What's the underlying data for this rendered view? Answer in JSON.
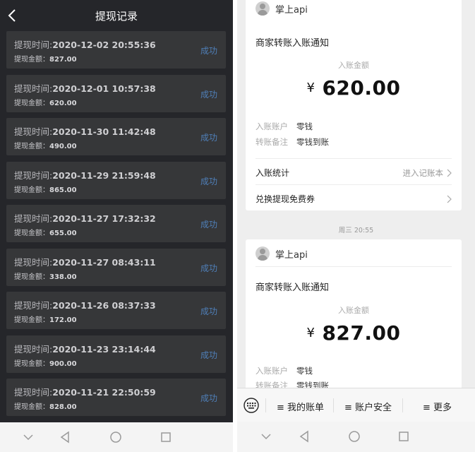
{
  "left": {
    "header_title": "提现记录",
    "time_prefix": "提现时间:",
    "amount_prefix": "提现金额：",
    "records": [
      {
        "time": "2020-12-02 20:55:36",
        "amount": "827.00",
        "status": "成功"
      },
      {
        "time": "2020-12-01 10:57:38",
        "amount": "620.00",
        "status": "成功"
      },
      {
        "time": "2020-11-30 11:42:48",
        "amount": "490.00",
        "status": "成功"
      },
      {
        "time": "2020-11-29 21:59:48",
        "amount": "865.00",
        "status": "成功"
      },
      {
        "time": "2020-11-27 17:32:32",
        "amount": "655.00",
        "status": "成功"
      },
      {
        "time": "2020-11-27 08:43:11",
        "amount": "338.00",
        "status": "成功"
      },
      {
        "time": "2020-11-26 08:37:33",
        "amount": "172.00",
        "status": "成功"
      },
      {
        "time": "2020-11-23 23:14:44",
        "amount": "900.00",
        "status": "成功"
      },
      {
        "time": "2020-11-21 22:50:59",
        "amount": "828.00",
        "status": "成功"
      }
    ]
  },
  "right": {
    "cards": [
      {
        "sender": "掌上api",
        "title": "商家转账入账通知",
        "amount_label": "入账金额",
        "currency": "¥",
        "amount": "620.00",
        "account_label": "入账账户",
        "account_value": "零钱",
        "remark_label": "转账备注",
        "remark_value": "零钱到账",
        "stats_label": "入账统计",
        "stats_hint": "进入记账本",
        "coupon_label": "兑换提现免费券"
      },
      {
        "sender": "掌上api",
        "title": "商家转账入账通知",
        "amount_label": "入账金额",
        "currency": "¥",
        "amount": "827.00",
        "account_label": "入账账户",
        "account_value": "零钱",
        "remark_label": "转账备注",
        "remark_value": "零钱到账"
      }
    ],
    "time_separator": "周三 20:55",
    "menu": [
      "≡ 我的账单",
      "≡ 账户安全",
      "≡ 更多"
    ]
  },
  "colors": {
    "left_bg": "#25262a",
    "record_bg": "#363739",
    "status_blue": "#4f7fb8",
    "right_bg": "#eeeeee"
  }
}
